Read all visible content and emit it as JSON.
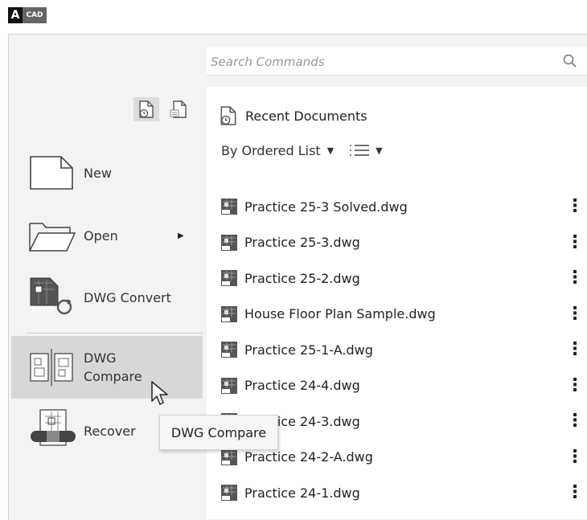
{
  "app": {
    "logo_letter": "A",
    "logo_product": "CAD"
  },
  "search": {
    "placeholder": "Search Commands"
  },
  "left_menu": [
    {
      "id": "new",
      "label": "New",
      "icon": "new-file-icon"
    },
    {
      "id": "open",
      "label": "Open",
      "icon": "open-folder-icon",
      "has_submenu": true
    },
    {
      "id": "dwg-convert",
      "label": "DWG Convert",
      "icon": "dwg-convert-icon",
      "icon_text": "DWG"
    },
    {
      "id": "dwg-compare",
      "label_line1": "DWG",
      "label_line2": "Compare",
      "icon": "dwg-compare-icon",
      "hovered": true
    },
    {
      "id": "recover",
      "label": "Recover",
      "icon": "recover-icon"
    }
  ],
  "recent": {
    "title": "Recent Documents",
    "sort_label": "By Ordered List",
    "documents": [
      "Practice 25-3 Solved.dwg",
      "Practice 25-3.dwg",
      "Practice 25-2.dwg",
      "House Floor Plan Sample.dwg",
      "Practice 25-1-A.dwg",
      "Practice 24-4.dwg",
      "Practice 24-3.dwg",
      "Practice 24-2-A.dwg",
      "Practice 24-1.dwg"
    ]
  },
  "tooltip": {
    "text": "DWG Compare"
  },
  "icons": {
    "more": "⋮",
    "submenu_arrow": "▶",
    "sort_caret": "▼"
  }
}
